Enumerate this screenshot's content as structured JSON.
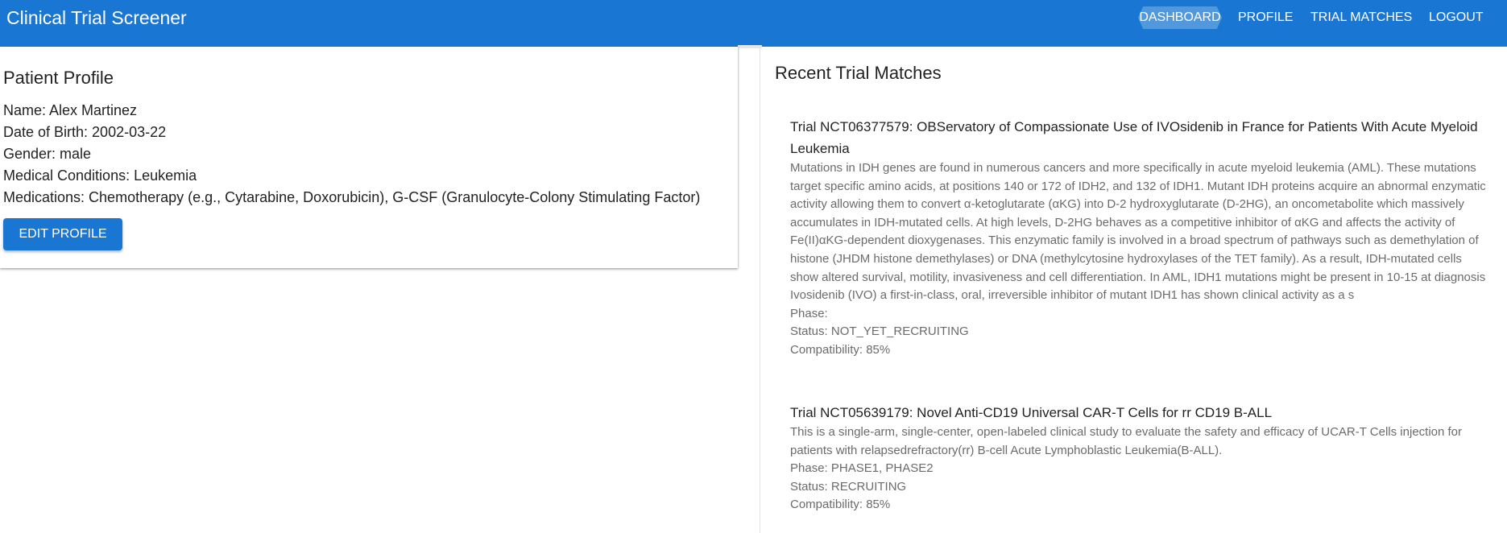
{
  "app": {
    "title": "Clinical Trial Screener"
  },
  "nav": [
    {
      "label": "DASHBOARD",
      "active": true
    },
    {
      "label": "PROFILE",
      "active": false
    },
    {
      "label": "TRIAL MATCHES",
      "active": false
    },
    {
      "label": "LOGOUT",
      "active": false
    }
  ],
  "profile": {
    "heading": "Patient Profile",
    "name": "Name: Alex Martinez",
    "dob": "Date of Birth: 2002-03-22",
    "gender": "Gender: male",
    "conditions": "Medical Conditions: Leukemia",
    "medications": "Medications: Chemotherapy (e.g., Cytarabine, Doxorubicin), G-CSF (Granulocyte-Colony Stimulating Factor)",
    "edit_label": "EDIT PROFILE"
  },
  "matches": {
    "heading": "Recent Trial Matches",
    "trials": [
      {
        "title": "Trial NCT06377579: OBServatory of Compassionate Use of IVOsidenib in France for Patients With Acute Myeloid Leukemia",
        "description": "Mutations in IDH genes are found in numerous cancers and more specifically in acute myeloid leukemia (AML). These mutations target specific amino acids, at positions 140 or 172 of IDH2, and 132 of IDH1. Mutant IDH proteins acquire an abnormal enzymatic activity allowing them to convert α-ketoglutarate (αKG) into D-2 hydroxyglutarate (D-2HG), an oncometabolite which massively accumulates in IDH-mutated cells. At high levels, D-2HG behaves as a competitive inhibitor of αKG and affects the activity of Fe(II)αKG-dependent dioxygenases. This enzymatic family is involved in a broad spectrum of pathways such as demethylation of histone (JHDM histone demethylases) or DNA (methylcytosine hydroxylases of the TET family). As a result, IDH-mutated cells show altered survival, motility, invasiveness and cell differentiation. In AML, IDH1 mutations might be present in 10-15 at diagnosis Ivosidenib (IVO) a first-in-class, oral, irreversible inhibitor of mutant IDH1 has shown clinical activity as a s",
        "phase": "Phase: ",
        "status": "Status: NOT_YET_RECRUITING",
        "compatibility": "Compatibility: 85%"
      },
      {
        "title": "Trial NCT05639179: Novel Anti-CD19 Universal CAR-T Cells for rr CD19 B-ALL",
        "description": "This is a single-arm, single-center, open-labeled clinical study to evaluate the safety and efficacy of UCAR-T Cells injection for patients with relapsedrefractory(rr) B-cell Acute Lymphoblastic Leukemia(B-ALL).",
        "phase": "Phase: PHASE1, PHASE2",
        "status": "Status: RECRUITING",
        "compatibility": "Compatibility: 85%"
      }
    ]
  }
}
